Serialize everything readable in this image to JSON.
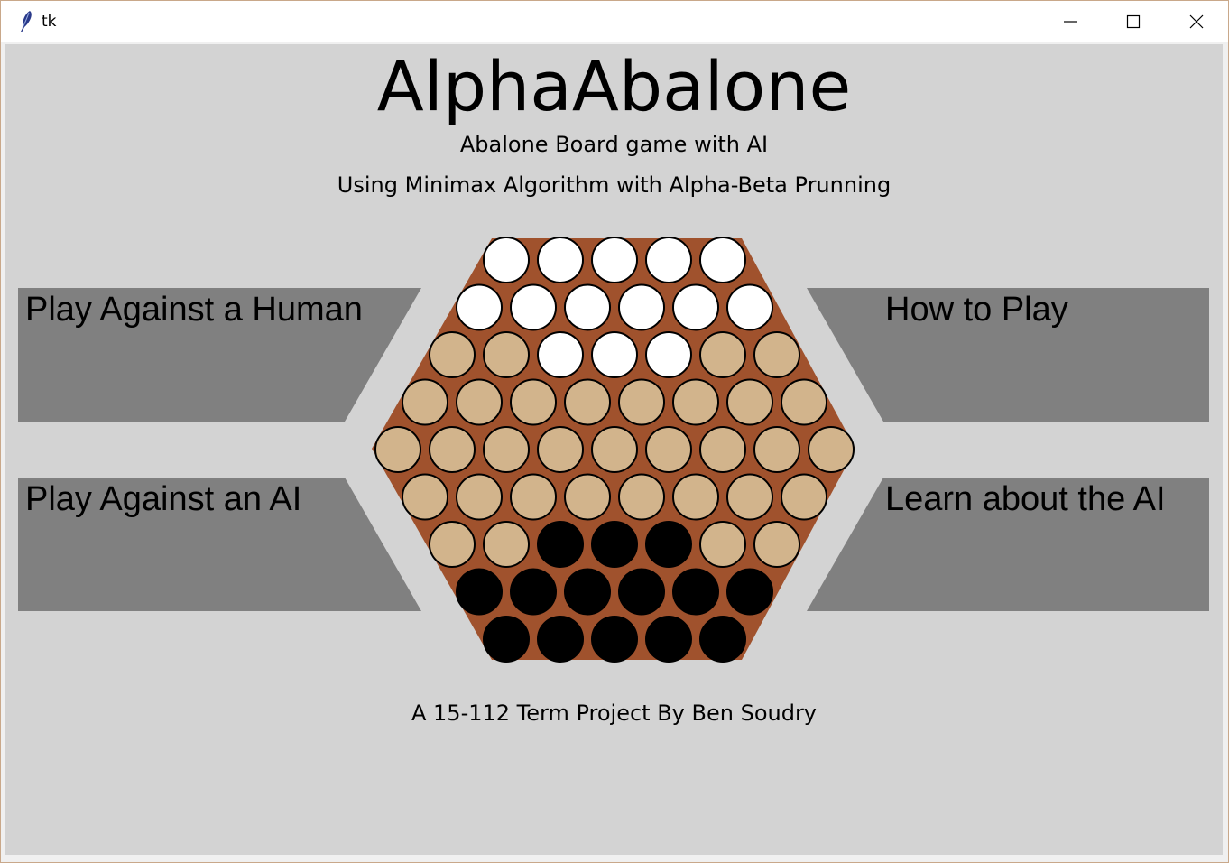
{
  "window": {
    "title": "tk"
  },
  "header": {
    "title": "AlphaAbalone",
    "subtitle": "Abalone Board game with AI",
    "tagline": "Using Minimax Algorithm with Alpha-Beta Prunning"
  },
  "menu": {
    "play_human": "Play Against a Human",
    "play_ai": "Play Against an AI",
    "how_to_play": "How to Play",
    "learn_ai": "Learn about the AI"
  },
  "footer": {
    "credit": "A 15-112 Term Project By Ben Soudry"
  },
  "colors": {
    "background": "#d3d3d3",
    "button": "#808080",
    "board": "#a0522d",
    "empty_cell": "#d2b48c",
    "white_piece": "#ffffff",
    "black_piece": "#000000"
  },
  "board": {
    "rows": [
      [
        "W",
        "W",
        "W",
        "W",
        "W"
      ],
      [
        "W",
        "W",
        "W",
        "W",
        "W",
        "W"
      ],
      [
        ".",
        ".",
        "W",
        "W",
        "W",
        ".",
        "."
      ],
      [
        ".",
        ".",
        ".",
        ".",
        ".",
        ".",
        ".",
        "."
      ],
      [
        ".",
        ".",
        ".",
        ".",
        ".",
        ".",
        ".",
        ".",
        "."
      ],
      [
        ".",
        ".",
        ".",
        ".",
        ".",
        ".",
        ".",
        "."
      ],
      [
        ".",
        ".",
        "B",
        "B",
        "B",
        ".",
        "."
      ],
      [
        "B",
        "B",
        "B",
        "B",
        "B",
        "B"
      ],
      [
        "B",
        "B",
        "B",
        "B",
        "B"
      ]
    ]
  }
}
